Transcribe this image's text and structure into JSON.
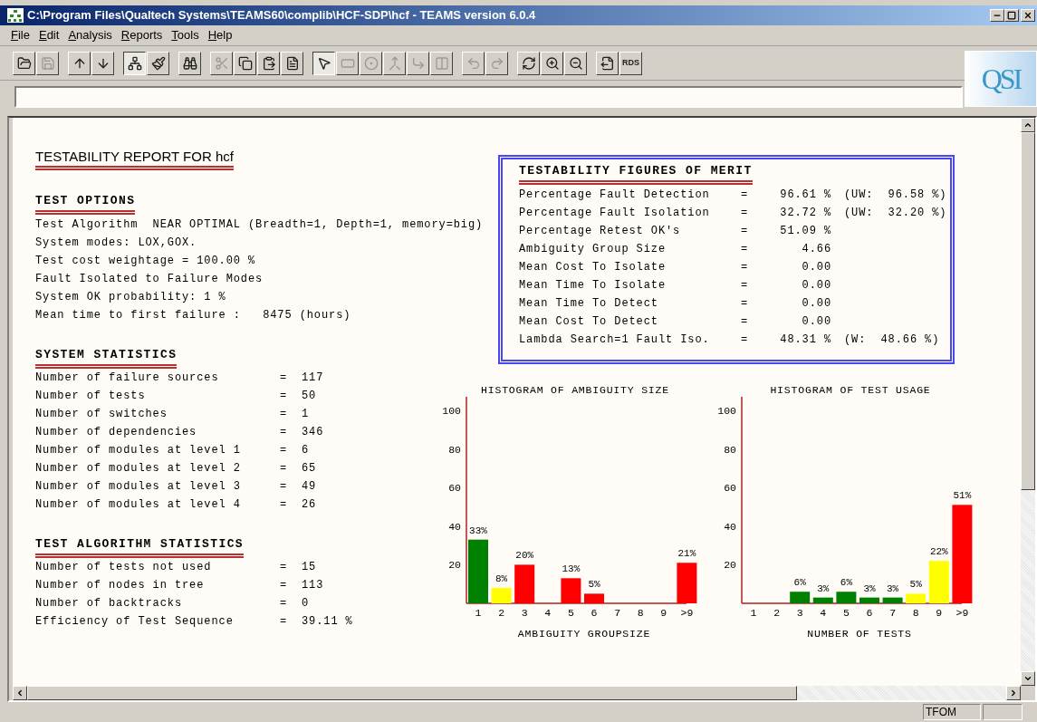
{
  "window": {
    "title": "C:\\Program Files\\Qualtech Systems\\TEAMS60\\complib\\HCF-SDP\\hcf - TEAMS version 6.0.4"
  },
  "menu": [
    "File",
    "Edit",
    "Analysis",
    "Reports",
    "Tools",
    "Help"
  ],
  "toolbar": [
    [
      {
        "kind": "icon",
        "pressed": false,
        "disabled": false
      },
      {
        "kind": "icon",
        "pressed": false,
        "disabled": true
      }
    ],
    [
      {
        "kind": "icon",
        "pressed": false,
        "disabled": false
      },
      {
        "kind": "icon",
        "pressed": false,
        "disabled": false
      }
    ],
    [
      {
        "kind": "icon",
        "pressed": true,
        "disabled": false
      },
      {
        "kind": "icon",
        "pressed": false,
        "disabled": false
      }
    ],
    [
      {
        "kind": "icon",
        "pressed": false,
        "disabled": false
      }
    ],
    [
      {
        "kind": "icon",
        "pressed": false,
        "disabled": true
      },
      {
        "kind": "icon",
        "pressed": false,
        "disabled": false
      },
      {
        "kind": "icon",
        "pressed": false,
        "disabled": false
      },
      {
        "kind": "icon",
        "pressed": false,
        "disabled": false
      }
    ],
    [
      {
        "kind": "icon",
        "pressed": true,
        "disabled": false
      },
      {
        "kind": "icon",
        "pressed": false,
        "disabled": true
      },
      {
        "kind": "icon",
        "pressed": false,
        "disabled": true
      },
      {
        "kind": "icon",
        "pressed": false,
        "disabled": true
      },
      {
        "kind": "icon",
        "pressed": false,
        "disabled": true
      },
      {
        "kind": "icon",
        "pressed": false,
        "disabled": true
      }
    ],
    [
      {
        "kind": "icon",
        "pressed": false,
        "disabled": true
      },
      {
        "kind": "icon",
        "pressed": false,
        "disabled": true
      }
    ],
    [
      {
        "kind": "icon",
        "pressed": false,
        "disabled": false
      },
      {
        "kind": "icon",
        "pressed": false,
        "disabled": false
      },
      {
        "kind": "icon",
        "pressed": false,
        "disabled": false
      }
    ],
    [
      {
        "kind": "icon",
        "pressed": false,
        "disabled": false
      },
      {
        "kind": "text",
        "label": "RDS",
        "pressed": false,
        "disabled": false
      }
    ]
  ],
  "logo": "QSI",
  "report": {
    "title": "TESTABILITY REPORT FOR hcf",
    "test_options": {
      "heading": "TEST OPTIONS",
      "lines": [
        "Test Algorithm  NEAR OPTIMAL (Breadth=1, Depth=1, memory=big)",
        "System modes: LOX,GOX.",
        "Test cost weightage = 100.00 %",
        "Fault Isolated to Failure Modes",
        "System OK probability: 1 %",
        "Mean time to first failure :   8475 (hours)"
      ]
    },
    "system_statistics": {
      "heading": "SYSTEM STATISTICS",
      "rows": [
        {
          "label": "Number of failure sources",
          "equals": "=",
          "value": "117"
        },
        {
          "label": "Number of tests",
          "equals": "=",
          "value": "50"
        },
        {
          "label": "Number of switches",
          "equals": "=",
          "value": "1"
        },
        {
          "label": "Number of dependencies",
          "equals": "=",
          "value": "346"
        },
        {
          "label": "Number of modules at level 1",
          "equals": "=",
          "value": "6"
        },
        {
          "label": "Number of modules at level 2",
          "equals": "=",
          "value": "65"
        },
        {
          "label": "Number of modules at level 3",
          "equals": "=",
          "value": "49"
        },
        {
          "label": "Number of modules at level 4",
          "equals": "=",
          "value": "26"
        }
      ]
    },
    "algorithm_statistics": {
      "heading": "TEST ALGORITHM STATISTICS",
      "rows": [
        {
          "label": "Number of tests not used",
          "equals": "=",
          "value": "15"
        },
        {
          "label": "Number of nodes in tree",
          "equals": "=",
          "value": "113"
        },
        {
          "label": "Number of backtracks",
          "equals": "=",
          "value": "0"
        },
        {
          "label": "Efficiency of Test Sequence",
          "equals": "=",
          "value": "39.11 %"
        }
      ]
    },
    "figures_of_merit": {
      "heading": "TESTABILITY FIGURES OF MERIT",
      "rows": [
        {
          "label": "Percentage Fault Detection",
          "equals": "=",
          "value": "96.61 %",
          "extra": "(UW:  96.58 %)"
        },
        {
          "label": "Percentage Fault Isolation",
          "equals": "=",
          "value": "32.72 %",
          "extra": "(UW:  32.20 %)"
        },
        {
          "label": "Percentage Retest OK's",
          "equals": "=",
          "value": "51.09 %"
        },
        {
          "label": "Ambiguity Group Size",
          "equals": "=",
          "value": "4.66"
        },
        {
          "label": "Mean Cost To Isolate",
          "equals": "=",
          "value": "0.00"
        },
        {
          "label": "Mean Time To Isolate",
          "equals": "=",
          "value": "0.00"
        },
        {
          "label": "Mean Time To Detect",
          "equals": "=",
          "value": "0.00"
        },
        {
          "label": "Mean Cost To Detect",
          "equals": "=",
          "value": "0.00"
        },
        {
          "label": "Lambda Search=1 Fault Iso.",
          "equals": "=",
          "value": "48.31 %",
          "extra": "(W:  48.66 %)"
        }
      ]
    },
    "histograms": [
      {
        "chart_data": {
          "type": "bar",
          "title": "HISTOGRAM OF AMBIGUITY SIZE",
          "xlabel": "AMBIGUITY GROUPSIZE",
          "categories": [
            "1",
            "2",
            "3",
            "4",
            "5",
            "6",
            "7",
            "8",
            "9",
            ">9"
          ],
          "stacked": true,
          "series": [
            {
              "color": "#008000",
              "values": [
                33,
                null,
                null,
                null,
                null,
                null,
                null,
                null,
                null,
                null
              ]
            },
            {
              "color": "#ffff00",
              "values": [
                null,
                8,
                null,
                null,
                null,
                null,
                null,
                null,
                null,
                null
              ]
            },
            {
              "color": "#ff0000",
              "values": [
                null,
                null,
                20,
                null,
                13,
                5,
                null,
                null,
                null,
                21
              ]
            }
          ],
          "ylim": [
            0,
            107
          ],
          "yticks": [
            20,
            40,
            60,
            80,
            100
          ],
          "value_labels": [
            "33%",
            "8%",
            "20%",
            null,
            "13%",
            "5%",
            null,
            null,
            null,
            "21%"
          ]
        }
      },
      {
        "chart_data": {
          "type": "bar",
          "title": "HISTOGRAM OF TEST USAGE",
          "xlabel": "NUMBER OF TESTS",
          "categories": [
            "1",
            "2",
            "3",
            "4",
            "5",
            "6",
            "7",
            "8",
            "9",
            ">9"
          ],
          "stacked": true,
          "series": [
            {
              "color": "#008000",
              "values": [
                null,
                null,
                6,
                3,
                6,
                3,
                3,
                null,
                null,
                null
              ]
            },
            {
              "color": "#ffff00",
              "values": [
                null,
                null,
                null,
                null,
                null,
                null,
                null,
                5,
                22,
                null
              ]
            },
            {
              "color": "#ff0000",
              "values": [
                null,
                null,
                null,
                null,
                null,
                null,
                null,
                null,
                null,
                51
              ]
            }
          ],
          "ylim": [
            0,
            107
          ],
          "yticks": [
            20,
            40,
            60,
            80,
            100
          ],
          "value_labels": [
            null,
            null,
            "6%",
            "3%",
            "6%",
            "3%",
            "3%",
            "5%",
            "22%",
            "51%"
          ]
        }
      }
    ]
  },
  "status_bar": [
    "TFOM"
  ]
}
